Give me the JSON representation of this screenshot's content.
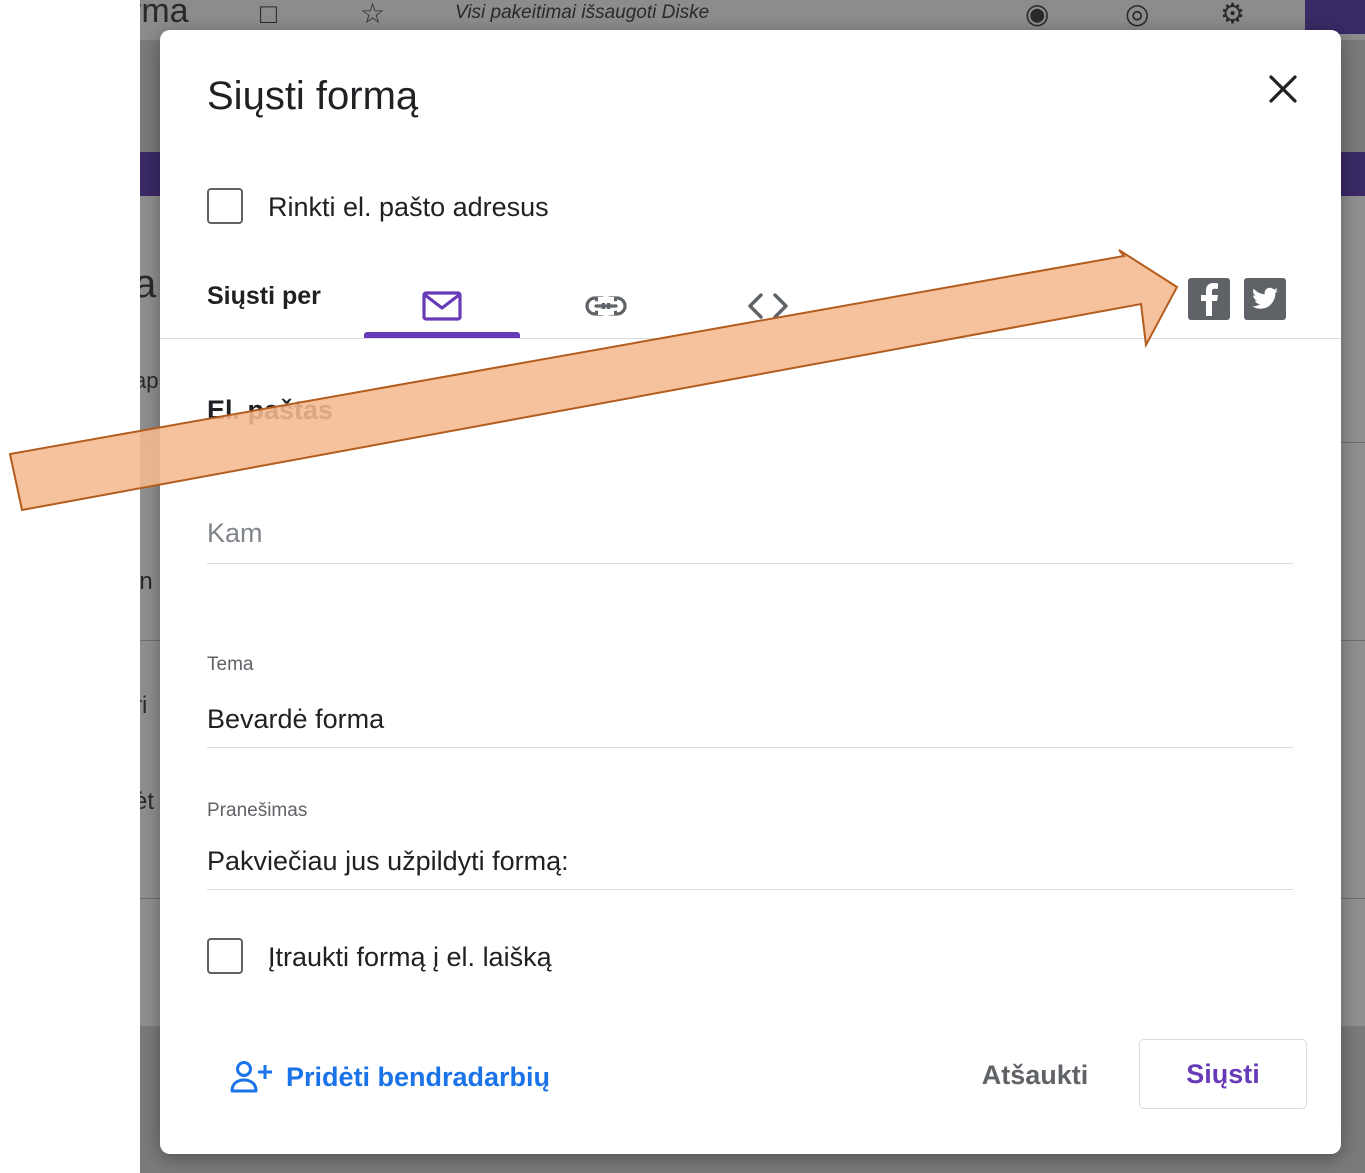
{
  "background_app": {
    "doc_title": "rma",
    "status_text": "Visi pakeitimai išsaugoti Diske",
    "fragments": [
      "a",
      "ap",
      "in",
      "ri",
      "ėt"
    ]
  },
  "dialog": {
    "title": "Siųsti formą",
    "collect_emails_label": "Rinkti el. pašto adresus",
    "send_via_label": "Siųsti per",
    "section_heading": "El. paštas",
    "to_field": {
      "placeholder": "Kam",
      "value": ""
    },
    "subject_field": {
      "label": "Tema",
      "value": "Bevardė forma"
    },
    "message_field": {
      "label": "Pranešimas",
      "value": "Pakviečiau jus užpildyti formą:"
    },
    "include_form_label": "Įtraukti formą į el. laišką",
    "add_collaborators_label": "Pridėti bendradarbių",
    "cancel_label": "Atšaukti",
    "send_label": "Siųsti",
    "tabs": [
      {
        "icon": "email-icon",
        "active": true
      },
      {
        "icon": "link-icon",
        "active": false
      },
      {
        "icon": "embed-code-icon",
        "active": false
      }
    ],
    "social": [
      "facebook-icon",
      "twitter-icon"
    ]
  },
  "colors": {
    "accent": "#673ab7",
    "link_blue": "#1a73e8",
    "arrow_fill": "#f4b98f",
    "arrow_stroke": "#b35c1e"
  }
}
